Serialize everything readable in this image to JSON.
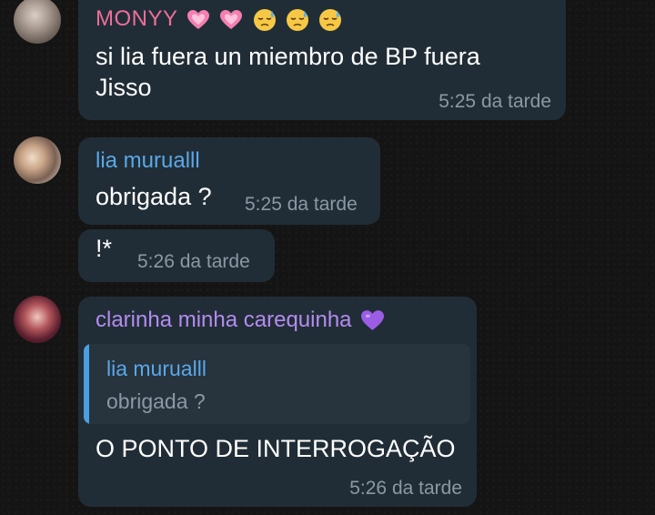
{
  "messages": [
    {
      "sender": "MONYY",
      "text_line1": "si lia fuera un miembro de BP fuera",
      "text_line2": "Jisso",
      "time": "5:25 da tarde"
    },
    {
      "sender": "lia murualll",
      "text": "obrigada ?",
      "time": "5:25 da tarde"
    },
    {
      "text": "!*",
      "time": "5:26 da tarde"
    },
    {
      "sender": "clarinha minha carequinha",
      "reply": {
        "name": "lia murualll",
        "text": "obrigada ?"
      },
      "text": "O PONTO DE INTERROGAÇÃO",
      "time": "5:26 da tarde"
    }
  ],
  "icons": {
    "monyy_badges": [
      "pink-heart-icon",
      "pink-heart-icon",
      "sweat-face-icon",
      "sweat-face-icon",
      "sweat-face-icon"
    ],
    "clarinha_badge": "purple-heart-icon"
  },
  "colors": {
    "bubble": "#212d36",
    "monyy_name": "#ee6e9a",
    "lia_name": "#5aa8e8",
    "clarinha_name": "#b48cf0",
    "timestamp": "#8a99a5",
    "reply_bar": "#4a9fe0"
  }
}
